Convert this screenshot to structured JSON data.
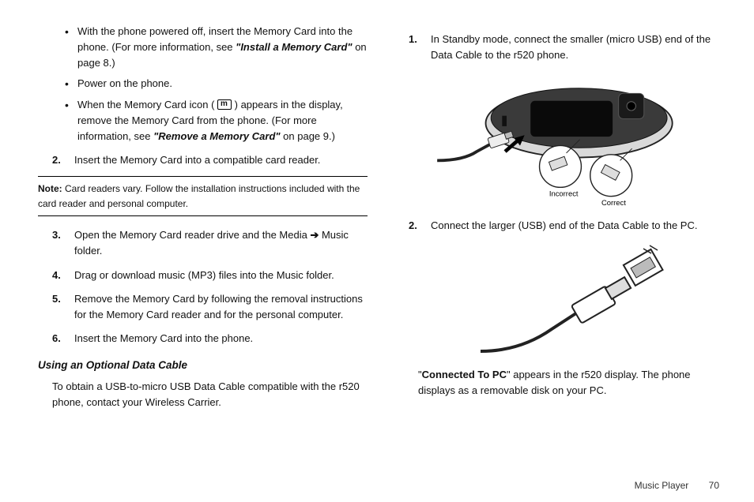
{
  "left": {
    "bullets": [
      {
        "pre": "With the phone powered off, insert the Memory Card into the phone. (For more information, see ",
        "ref": "\"Install a Memory Card\"",
        "post": " on page 8.)"
      },
      {
        "pre": "Power on the phone.",
        "ref": "",
        "post": ""
      },
      {
        "pre": "When the Memory Card icon ( ",
        "icon": true,
        "mid": " ) appears in the display, remove the Memory Card from the phone. (For more information, see ",
        "ref": "\"Remove a Memory Card\"",
        "post": " on page 9.)"
      }
    ],
    "step2": {
      "num": "2.",
      "text": "Insert the Memory Card into a compatible card reader."
    },
    "note_label": "Note:",
    "note_text": " Card readers vary. Follow the installation instructions included with the card reader and personal computer.",
    "step3": {
      "num": "3.",
      "pre": "Open the Memory Card reader drive and the Media ",
      "arrow": "➔",
      "post": " Music folder."
    },
    "step4": {
      "num": "4.",
      "text": "Drag or download music (MP3) files into the Music folder."
    },
    "step5": {
      "num": "5.",
      "text": "Remove the Memory Card by following the removal instructions for the Memory Card reader and for the personal computer."
    },
    "step6": {
      "num": "6.",
      "text": "Insert the Memory Card into the phone."
    },
    "subhead": "Using an Optional Data Cable",
    "para": "To obtain a USB-to-micro USB Data Cable compatible with the r520 phone, contact your Wireless Carrier."
  },
  "right": {
    "step1": {
      "num": "1.",
      "text": "In Standby mode, connect the smaller (micro USB) end of the Data Cable to the r520 phone."
    },
    "fig_phone_labels": {
      "incorrect": "Incorrect",
      "correct": "Correct"
    },
    "step2": {
      "num": "2.",
      "text": "Connect the larger (USB) end of the Data Cable to the PC."
    },
    "connected_pre": "\"",
    "connected_bold": "Connected To PC",
    "connected_post": "\" appears in the r520 display. The phone displays as a removable disk on your PC."
  },
  "footer": {
    "section": "Music Player",
    "page": "70"
  }
}
